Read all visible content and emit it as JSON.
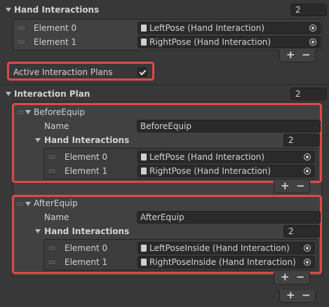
{
  "hand_interactions": {
    "label": "Hand Interactions",
    "count": "2",
    "elements": [
      {
        "label": "Element 0",
        "value": "LeftPose (Hand Interaction)"
      },
      {
        "label": "Element 1",
        "value": "RightPose (Hand Interaction)"
      }
    ],
    "add": "+",
    "remove": "−"
  },
  "active_interaction_plans": {
    "label": "Active Interaction Plans",
    "checked": true
  },
  "interaction_plan": {
    "label": "Interaction Plan",
    "count": "2",
    "items": [
      {
        "header": "BeforeEquip",
        "name_label": "Name",
        "name_value": "BeforeEquip",
        "hand_label": "Hand Interactions",
        "hand_count": "2",
        "elements": [
          {
            "label": "Element 0",
            "value": "LeftPose (Hand Interaction)"
          },
          {
            "label": "Element 1",
            "value": "RightPose (Hand Interaction)"
          }
        ]
      },
      {
        "header": "AfterEquip",
        "name_label": "Name",
        "name_value": "AfterEquip",
        "hand_label": "Hand Interactions",
        "hand_count": "2",
        "elements": [
          {
            "label": "Element 0",
            "value": "LeftPoseInside (Hand Interaction)"
          },
          {
            "label": "Element 1",
            "value": "RightPoseInside (Hand Interaction)"
          }
        ]
      }
    ],
    "add": "+",
    "remove": "−"
  },
  "colors": {
    "background": "#383838",
    "highlight": "#e04848",
    "text": "#d2d2d2"
  }
}
